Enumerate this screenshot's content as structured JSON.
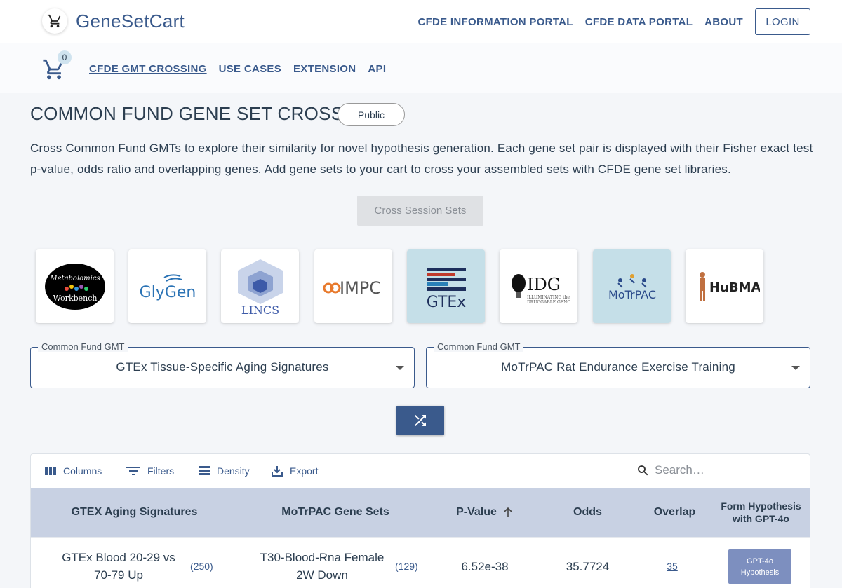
{
  "header": {
    "brand": "GeneSetCart",
    "nav": [
      "CFDE INFORMATION PORTAL",
      "CFDE DATA PORTAL",
      "ABOUT"
    ],
    "login_label": "LOGIN"
  },
  "subnav": {
    "cart_count": "0",
    "links": [
      "CFDE GMT CROSSING",
      "USE CASES",
      "EXTENSION",
      "API"
    ],
    "active": "CFDE GMT CROSSING"
  },
  "main": {
    "title": "COMMON FUND GENE SET CROSSING",
    "visibility_chip": "Public",
    "description": "Cross Common Fund GMTs to explore their similarity for novel hypothesis generation. Each gene set pair is displayed with their Fisher exact test p-value, odds ratio and overlapping genes. Add gene sets to your cart to cross your assembled sets with CFDE gene set libraries.",
    "cross_button": "Cross Session Sets"
  },
  "logos": [
    {
      "name": "Metabolomics Workbench",
      "text": "Metabolomics Workbench",
      "selected": false
    },
    {
      "name": "GlyGen",
      "text": "GlyGen",
      "selected": false
    },
    {
      "name": "LINCS",
      "text": "LINCS",
      "selected": false
    },
    {
      "name": "IMPC",
      "text": "IMPC",
      "selected": false
    },
    {
      "name": "GTEx",
      "text": "GTEx",
      "selected": true
    },
    {
      "name": "IDG",
      "text": "IDG",
      "selected": false
    },
    {
      "name": "MoTrPAC",
      "text": "MoTrPAC",
      "selected": true
    },
    {
      "name": "HuBMAP",
      "text": "HuBMAP",
      "selected": false
    }
  ],
  "selects": [
    {
      "legend": "Common Fund GMT",
      "value": "GTEx Tissue-Specific Aging Signatures"
    },
    {
      "legend": "Common Fund GMT",
      "value": "MoTrPAC Rat Endurance Exercise Training"
    }
  ],
  "grid": {
    "toolbar": {
      "columns": "Columns",
      "filters": "Filters",
      "density": "Density",
      "export": "Export",
      "search_placeholder": "Search…"
    },
    "headers": {
      "col1": "GTEX Aging Signatures",
      "col2": "MoTrPAC Gene Sets",
      "col3": "P-Value",
      "col4": "Odds",
      "col5": "Overlap",
      "col6_line1": "Form Hypothesis",
      "col6_line2": "with GPT-4o"
    },
    "rows": [
      {
        "set1_line1": "GTEx Blood 20-29 vs",
        "set1_line2": "70-79 Up",
        "set1_count": "(250)",
        "set2_line1": "T30-Blood-Rna Female",
        "set2_line2": "2W Down",
        "set2_count": "(129)",
        "pvalue": "6.52e-38",
        "odds": "35.7724",
        "overlap": "35",
        "gpt_line1": "GPT-4o",
        "gpt_line2": "Hypothesis"
      }
    ]
  },
  "colors": {
    "primary": "#3a5a8c",
    "header_bg": "#c8d1e3",
    "selected_logo_bg": "#c5dfe8",
    "gpt_button": "#7d8fbf",
    "page_bg": "#f4f6f9"
  }
}
